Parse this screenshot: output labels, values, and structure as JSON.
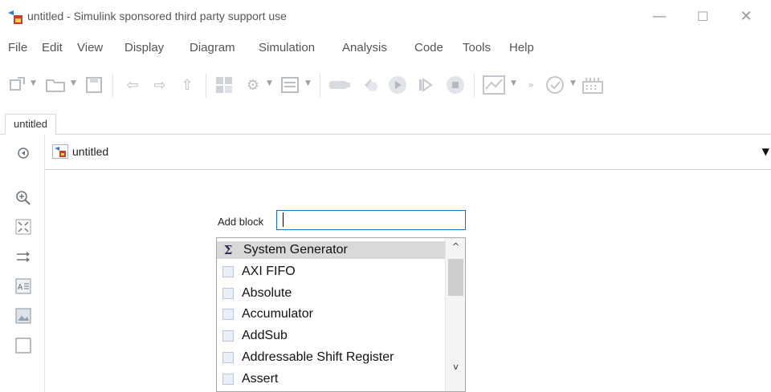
{
  "window": {
    "title": "untitled - Simulink sponsored third party support use",
    "minimize_glyph": "—",
    "maximize_glyph": "☐",
    "close_glyph": "✕"
  },
  "menu": {
    "items": [
      "File",
      "Edit",
      "View",
      "Display",
      "Diagram",
      "Simulation",
      "Analysis",
      "Code",
      "Tools",
      "Help"
    ]
  },
  "toolbar": {
    "icons": [
      "new-model-icon",
      "open-icon",
      "save-icon",
      "back-icon",
      "forward-icon",
      "up-icon",
      "library-browser-icon",
      "model-settings-icon",
      "model-explorer-icon",
      "record-icon",
      "step-back-icon",
      "run-icon",
      "step-forward-icon",
      "stop-icon",
      "data-inspector-icon",
      "more-icon",
      "model-advisor-icon",
      "build-icon"
    ],
    "overflow_glyph": "»"
  },
  "tabs": [
    {
      "label": "untitled"
    }
  ],
  "address_bar": {
    "path": "untitled"
  },
  "palette": {
    "icons": [
      "hide-browser-icon",
      "zoom-icon",
      "fit-view-icon",
      "route-lines-icon",
      "annotation-icon",
      "image-icon",
      "area-icon"
    ]
  },
  "add_block": {
    "label": "Add block",
    "value": "",
    "results": [
      {
        "label": "System Generator",
        "selected": true,
        "icon": "sigma-icon"
      },
      {
        "label": "AXI FIFO",
        "selected": false,
        "icon": "block-icon"
      },
      {
        "label": "Absolute",
        "selected": false,
        "icon": "block-icon"
      },
      {
        "label": "Accumulator",
        "selected": false,
        "icon": "block-icon"
      },
      {
        "label": "AddSub",
        "selected": false,
        "icon": "block-icon"
      },
      {
        "label": "Addressable Shift Register",
        "selected": false,
        "icon": "block-icon"
      },
      {
        "label": "Assert",
        "selected": false,
        "icon": "block-icon"
      }
    ],
    "scroll_up_glyph": "^",
    "scroll_down_glyph": "v"
  },
  "colors": {
    "input_border": "#1a73c9",
    "selection": "#d9d9d9",
    "toolbar_disabled": "#b9bec5"
  }
}
